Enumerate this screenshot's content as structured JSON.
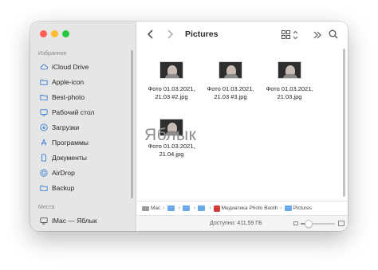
{
  "window": {
    "title": "Pictures"
  },
  "sidebar": {
    "favorites_label": "Избранное",
    "places_label": "Места",
    "items": [
      {
        "label": "iCloud Drive",
        "icon": "cloud-icon"
      },
      {
        "label": "Apple-icon",
        "icon": "folder-icon"
      },
      {
        "label": "Best-photo",
        "icon": "folder-icon"
      },
      {
        "label": "Рабочий стол",
        "icon": "desktop-icon"
      },
      {
        "label": "Загрузки",
        "icon": "download-icon"
      },
      {
        "label": "Программы",
        "icon": "apps-icon"
      },
      {
        "label": "Документы",
        "icon": "document-icon"
      },
      {
        "label": "AirDrop",
        "icon": "airdrop-icon"
      },
      {
        "label": "Backup",
        "icon": "folder-icon"
      }
    ],
    "places": [
      {
        "label": "iMac — Яблык",
        "icon": "imac-icon"
      }
    ]
  },
  "files": [
    {
      "name_line1": "Фото 01.03.2021,",
      "name_line2": "21.03 #2.jpg"
    },
    {
      "name_line1": "Фото 01.03.2021,",
      "name_line2": "21.03 #3.jpg"
    },
    {
      "name_line1": "Фото 01.03.2021,",
      "name_line2": "21.03.jpg"
    },
    {
      "name_line1": "Фото 01.03.2021,",
      "name_line2": "21.04.jpg"
    }
  ],
  "pathbar": {
    "seg1": "Mac",
    "seg2": "",
    "seg3": "",
    "seg4": "",
    "seg5": "Медиатека Photo Booth",
    "seg6": "Pictures",
    "separator": "›"
  },
  "statusbar": {
    "text": "Доступно: 411,59 ГБ"
  },
  "watermark": "Яблык",
  "colors": {
    "close": "#fe5f57",
    "minimize": "#febc2e",
    "maximize": "#28c840",
    "sidebar_bg": "#e6e6e6",
    "icon_accent": "#3b7fd4"
  }
}
